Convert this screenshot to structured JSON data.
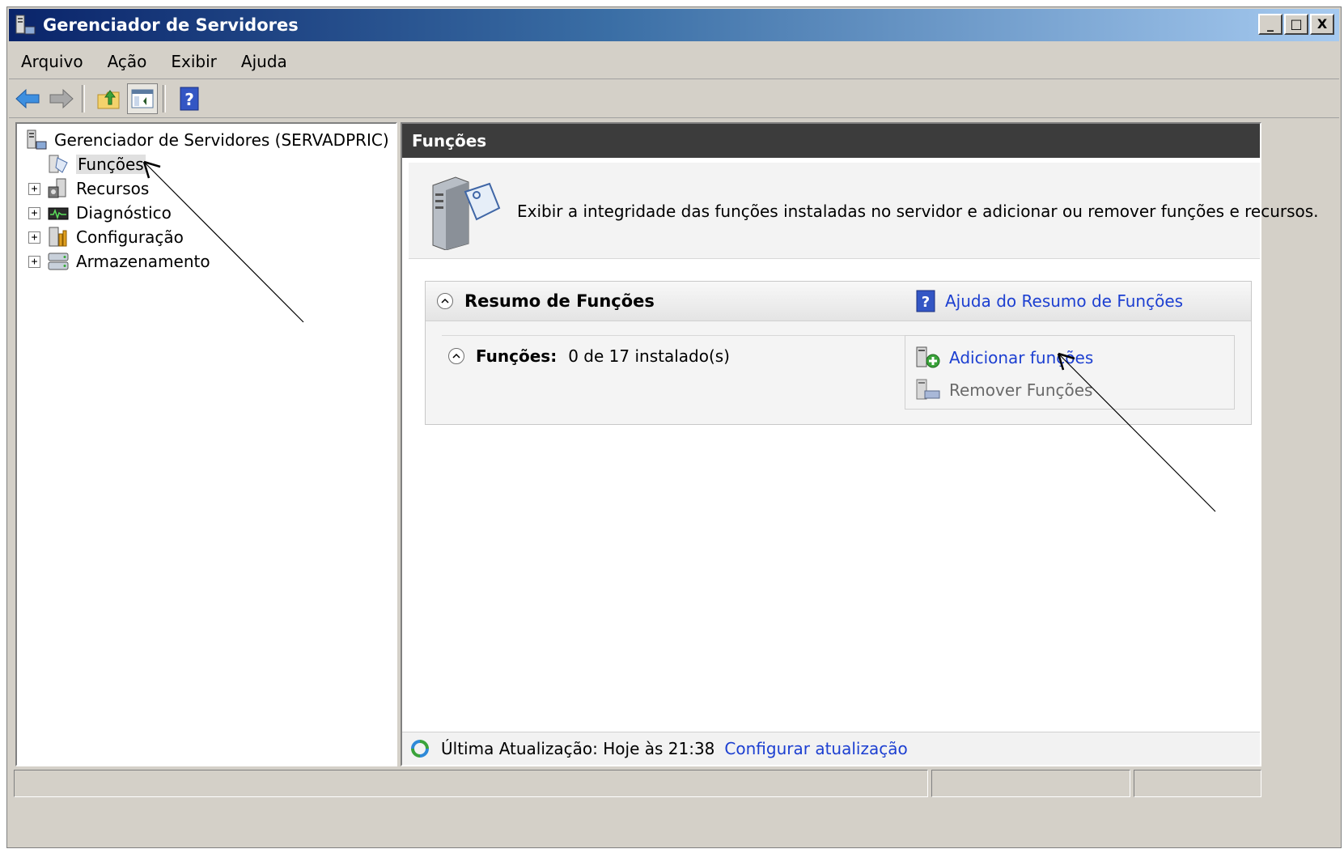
{
  "window": {
    "title": "Gerenciador de Servidores",
    "controls": {
      "minimize": "_",
      "maximize": "□",
      "close": "X"
    }
  },
  "menu": [
    "Arquivo",
    "Ação",
    "Exibir",
    "Ajuda"
  ],
  "toolbar": {
    "buttons": [
      "back-arrow-icon",
      "forward-arrow-icon",
      "up-folder-icon",
      "show-hide-tree-icon",
      "help-icon"
    ]
  },
  "tree": {
    "root": "Gerenciador de Servidores (SERVADPRIC)",
    "nodes": [
      {
        "label": "Funções",
        "selected": true,
        "expandable": false
      },
      {
        "label": "Recursos",
        "expandable": true
      },
      {
        "label": "Diagnóstico",
        "expandable": true
      },
      {
        "label": "Configuração",
        "expandable": true
      },
      {
        "label": "Armazenamento",
        "expandable": true
      }
    ],
    "expander_symbol": "+"
  },
  "content": {
    "header": "Funções",
    "description": "Exibir a integridade das funções instaladas no servidor e adicionar ou remover funções e recursos.",
    "summary": {
      "title": "Resumo de Funções",
      "help_link": "Ajuda do Resumo de Funções",
      "roles_label": "Funções:",
      "roles_value": "0 de 17 instalado(s)",
      "add_roles": "Adicionar funções",
      "remove_roles": "Remover Funções",
      "collapse_symbol": "^"
    },
    "refresh": {
      "text": "Última Atualização: Hoje às 21:38",
      "link": "Configurar atualização"
    }
  },
  "colors": {
    "title_gradient_start": "#0a246a",
    "title_gradient_end": "#a6caf0",
    "pane_header": "#3c3c3c",
    "link": "#1c3fd1",
    "disabled": "#6a6a6a",
    "chrome": "#d4d0c8"
  }
}
